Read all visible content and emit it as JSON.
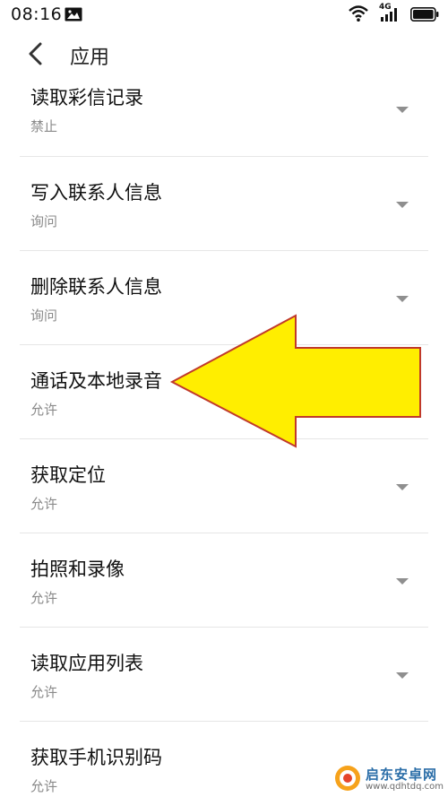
{
  "status_bar": {
    "time": "08:16",
    "network": "4G"
  },
  "header": {
    "title": "应用"
  },
  "permissions": [
    {
      "title": "读取彩信记录",
      "value": "禁止"
    },
    {
      "title": "写入联系人信息",
      "value": "询问"
    },
    {
      "title": "删除联系人信息",
      "value": "询问"
    },
    {
      "title": "通话及本地录音",
      "value": "允许"
    },
    {
      "title": "获取定位",
      "value": "允许"
    },
    {
      "title": "拍照和录像",
      "value": "允许"
    },
    {
      "title": "读取应用列表",
      "value": "允许"
    },
    {
      "title": "获取手机识别码",
      "value": "允许"
    }
  ],
  "annotation": {
    "arrow_fill": "#ffee00",
    "arrow_stroke": "#c0392b"
  },
  "watermark": {
    "name": "启东安卓网",
    "url": "www.qdhtdq.com"
  },
  "colors": {
    "text_primary": "#111111",
    "text_secondary": "#8a8a8a",
    "divider": "#e6e6e6"
  }
}
